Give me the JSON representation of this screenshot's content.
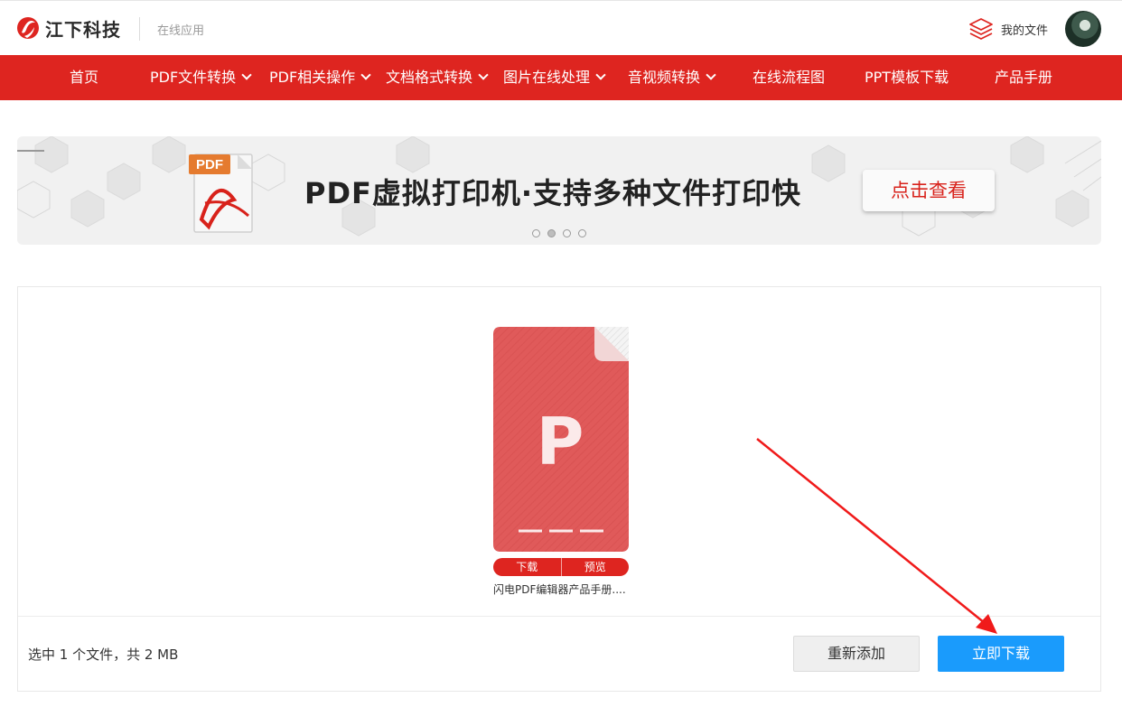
{
  "header": {
    "brand": "江下科技",
    "subtitle": "在线应用",
    "my_files": "我的文件"
  },
  "nav": {
    "items": [
      {
        "label": "首页",
        "dropdown": false
      },
      {
        "label": "PDF文件转换",
        "dropdown": true
      },
      {
        "label": "PDF相关操作",
        "dropdown": true
      },
      {
        "label": "文档格式转换",
        "dropdown": true
      },
      {
        "label": "图片在线处理",
        "dropdown": true
      },
      {
        "label": "音视频转换",
        "dropdown": true
      },
      {
        "label": "在线流程图",
        "dropdown": false
      },
      {
        "label": "PPT模板下载",
        "dropdown": false
      },
      {
        "label": "产品手册",
        "dropdown": false
      }
    ]
  },
  "banner": {
    "badge": "PDF",
    "title": "PDF虚拟打印机·支持多种文件打印快",
    "button": "点击查看",
    "slide_count": 4,
    "active_slide": 2
  },
  "file": {
    "icon_letter": "P",
    "download": "下载",
    "preview": "预览",
    "name": "闪电PDF编辑器产品手册...."
  },
  "footer": {
    "summary": "选中 1 个文件，共 2 MB",
    "readd_button": "重新添加",
    "download_button": "立即下载"
  },
  "colors": {
    "brand_red": "#de2520",
    "download_blue": "#1a9bfc",
    "file_red": "#e05a5a"
  }
}
